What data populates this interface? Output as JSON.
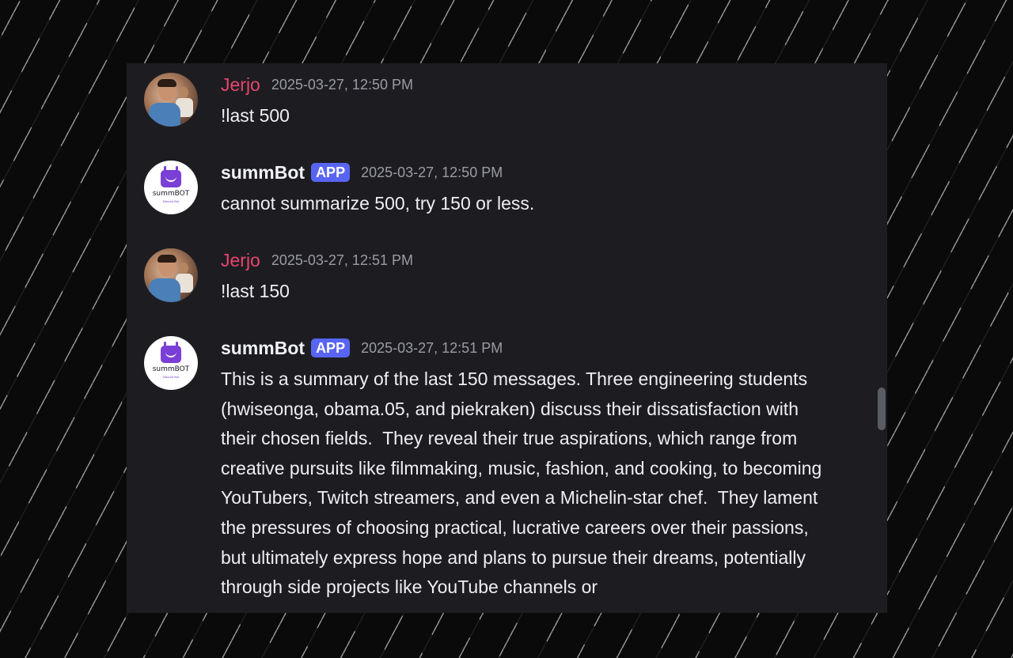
{
  "messages": [
    {
      "author": "Jerjo",
      "timestamp": "2025-03-27, 12:50 PM",
      "text": "!last 500"
    },
    {
      "author": "summBot",
      "badge": "APP",
      "timestamp": "2025-03-27, 12:50 PM",
      "text": "cannot summarize 500, try 150 or less."
    },
    {
      "author": "Jerjo",
      "timestamp": "2025-03-27, 12:51 PM",
      "text": "!last 150"
    },
    {
      "author": "summBot",
      "badge": "APP",
      "timestamp": "2025-03-27, 12:51 PM",
      "text": "This is a summary of the last 150 messages. Three engineering students (hwiseonga, obama.05, and piekraken) discuss their dissatisfaction with their chosen fields.  They reveal their true aspirations, which range from creative pursuits like filmmaking, music, fashion, and cooking, to becoming YouTubers, Twitch streamers, and even a Michelin-star chef.  They lament the pressures of choosing practical, lucrative careers over their passions, but ultimately express hope and plans to pursue their dreams, potentially through side projects like YouTube channels or"
    }
  ],
  "bot_avatar": {
    "logo_text": "summBOT",
    "logo_sub": "Discord Bot"
  },
  "colors": {
    "user_name": "#e8456e",
    "app_badge": "#5865f2",
    "panel": "#1d1d21"
  }
}
